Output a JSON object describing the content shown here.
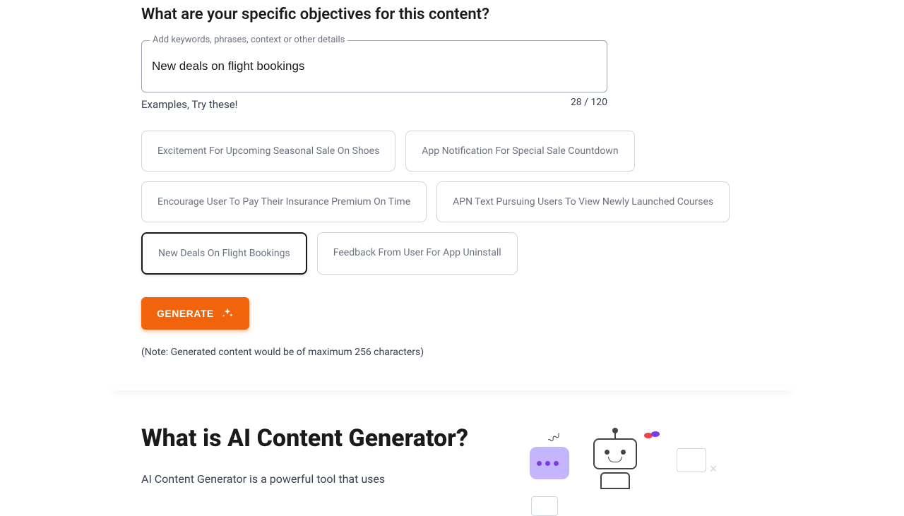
{
  "question": "What are your specific objectives for this content?",
  "input": {
    "label": "Add keywords, phrases, context or other details",
    "value": "New deals on flight bookings"
  },
  "charCount": "28 / 120",
  "examplesLabel": "Examples, Try these!",
  "chips": [
    {
      "text": "Excitement For Upcoming Seasonal Sale On Shoes",
      "selected": false
    },
    {
      "text": "App Notification For Special Sale Countdown",
      "selected": false
    },
    {
      "text": "Encourage User To Pay Their Insurance Premium On Time",
      "selected": false
    },
    {
      "text": "APN Text Pursuing Users To View Newly Launched Courses",
      "selected": false
    },
    {
      "text": "New Deals On Flight Bookings",
      "selected": true
    },
    {
      "text": "Feedback From User For App Uninstall",
      "selected": false
    }
  ],
  "generateLabel": "GENERATE",
  "note": "(Note: Generated content would be of maximum 256 characters)",
  "section2": {
    "title": "What is AI Content Generator?",
    "para": "AI Content Generator is a powerful tool that uses"
  }
}
